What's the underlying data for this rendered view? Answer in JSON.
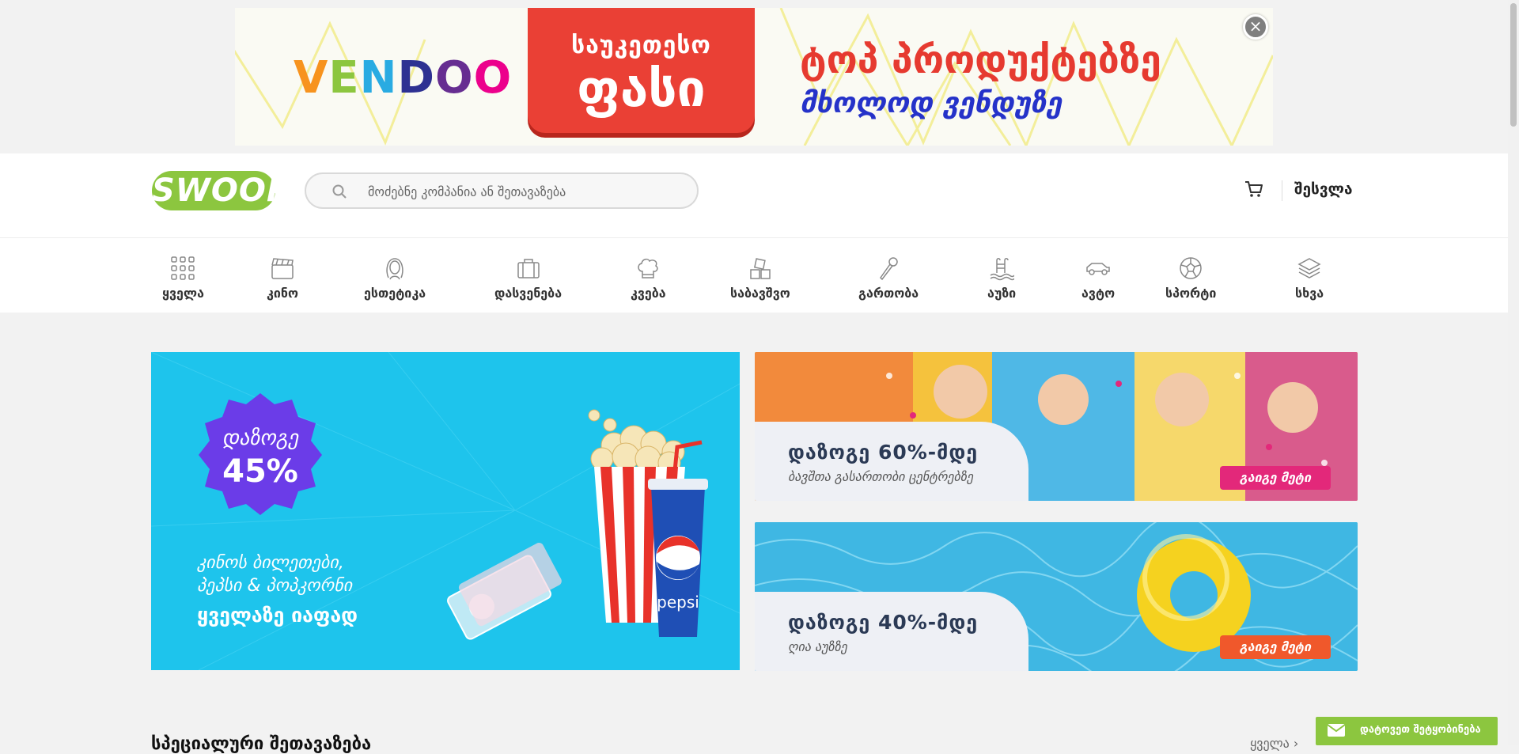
{
  "ad": {
    "brand": [
      "V",
      "E",
      "N",
      "D",
      "O",
      "O"
    ],
    "brand_colors": [
      "#f7931e",
      "#8cc63f",
      "#29abe2",
      "#2e3192",
      "#662d91",
      "#ec008c"
    ],
    "tag_line1": "საუკეთესო",
    "tag_line2": "ფასი",
    "headline1": "ტოპ პროდუქტებზე",
    "headline2": "მხოლოდ ვენდუზე",
    "close": "×"
  },
  "header": {
    "logo": "SWOOP",
    "search_placeholder": "მოძებნე კომპანია ან შეთავაზება",
    "login": "შესვლა"
  },
  "categories": [
    {
      "label": "ყველა",
      "icon": "grid-icon"
    },
    {
      "label": "კინო",
      "icon": "clapperboard-icon"
    },
    {
      "label": "ესთეტიკა",
      "icon": "woman-face-icon"
    },
    {
      "label": "დასვენება",
      "icon": "suitcase-icon"
    },
    {
      "label": "კვება",
      "icon": "chef-hat-icon"
    },
    {
      "label": "საბავშვო",
      "icon": "toy-blocks-icon"
    },
    {
      "label": "გართობა",
      "icon": "microphone-icon"
    },
    {
      "label": "აუზი",
      "icon": "pool-ladder-icon"
    },
    {
      "label": "ავტო",
      "icon": "car-icon"
    },
    {
      "label": "სპორტი",
      "icon": "soccer-ball-icon"
    },
    {
      "label": "სხვა",
      "icon": "layers-icon"
    }
  ],
  "promo_main": {
    "badge_line1": "დაზოგე",
    "badge_line2": "45%",
    "line1": "კინოს ბილეთები,",
    "line2": "პეპსი & პოპკორნი",
    "line3": "ყველაზე იაფად",
    "cup_brand": "pepsi"
  },
  "promo_a": {
    "title": "დაზოგე 60%-მდე",
    "subtitle": "ბავშთა გასართობი ცენტრებზე",
    "button": "გაიგე მეტი",
    "button_color": "#e3287a"
  },
  "promo_b": {
    "title": "დაზოგე 40%-მდე",
    "subtitle": "ღია აუზზე",
    "button": "გაიგე მეტი",
    "button_color": "#f0582b"
  },
  "section": {
    "title": "სპეციალური შეთავაზება",
    "see_all": "ყველა ›"
  },
  "notify": {
    "label": "დატოვეთ შეტყობინება"
  }
}
